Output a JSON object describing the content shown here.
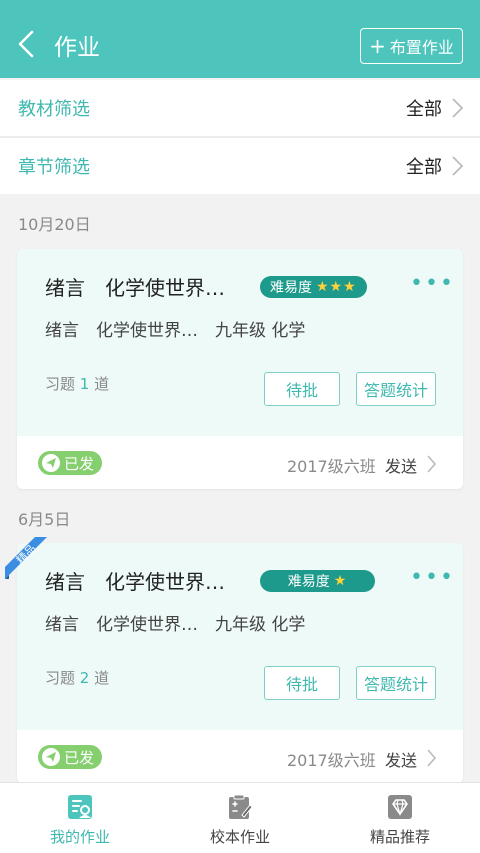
{
  "header": {
    "title": "作业",
    "assign_label": "布置作业"
  },
  "filters": [
    {
      "label": "教材筛选",
      "value": "全部"
    },
    {
      "label": "章节筛选",
      "value": "全部"
    }
  ],
  "groups": [
    {
      "date": "10月20日",
      "card": {
        "title": "绪言　化学使世界…",
        "difficulty_label": "难易度",
        "difficulty_stars": "★★★",
        "subtitle": "绪言　化学使世界…　九年级  化学",
        "count_prefix": "习题",
        "count": "1",
        "count_suffix": "道",
        "pending_label": "待批",
        "stats_label": "答题统计",
        "status": "已发",
        "class_name": "2017级六班",
        "send_label": "发送"
      }
    },
    {
      "date": "6月5日",
      "ribbon": "精品",
      "card": {
        "title": "绪言　化学使世界…",
        "difficulty_label": "难易度",
        "difficulty_stars": "★",
        "subtitle": "绪言　化学使世界…　九年级  化学",
        "count_prefix": "习题",
        "count": "2",
        "count_suffix": "道",
        "pending_label": "待批",
        "stats_label": "答题统计",
        "status": "已发",
        "class_name": "2017级六班",
        "send_label": "发送"
      }
    }
  ],
  "tabs": [
    {
      "label": "我的作业",
      "icon": "homework-icon",
      "active": true
    },
    {
      "label": "校本作业",
      "icon": "school-homework-icon",
      "active": false
    },
    {
      "label": "精品推荐",
      "icon": "diamond-icon",
      "active": false
    }
  ],
  "colors": {
    "accent": "#4dc5bd",
    "accent_dark": "#1e9a8c",
    "sent_green": "#86cf6e",
    "ribbon_blue": "#3a8de0",
    "star": "#ffd23a"
  }
}
